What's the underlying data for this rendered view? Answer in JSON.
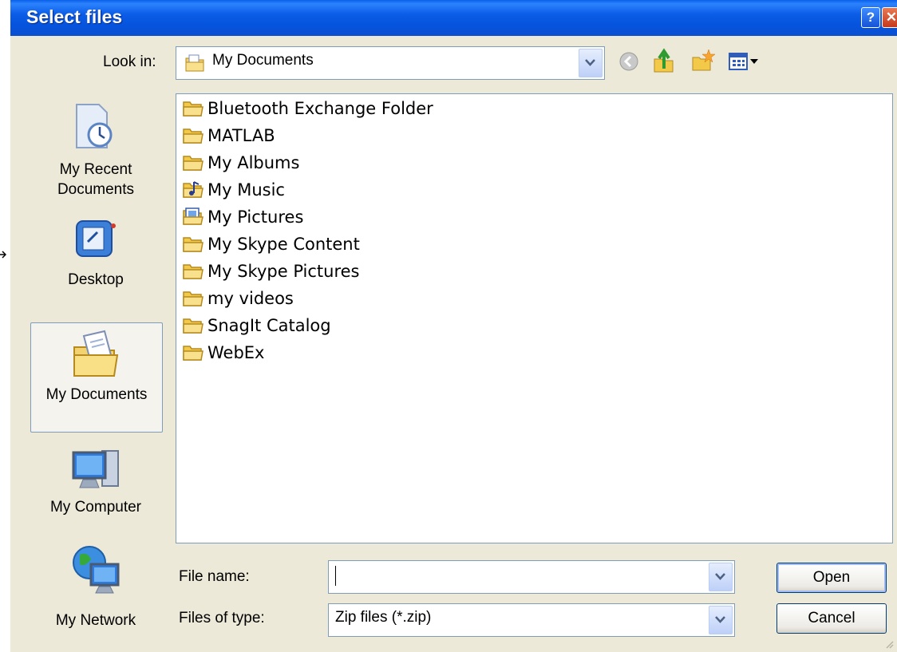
{
  "dialog": {
    "title": "Select files",
    "help_icon": "help-icon",
    "close_icon": "close-icon"
  },
  "look_in": {
    "label": "Look in:",
    "value": "My Documents"
  },
  "toolbar": {
    "icons": [
      "back-icon",
      "up-folder-icon",
      "new-folder-icon",
      "view-menu-icon"
    ]
  },
  "places": [
    {
      "label": "My Recent Documents",
      "line1": "My Recent",
      "line2": "Documents"
    },
    {
      "label": "Desktop"
    },
    {
      "label": "My Documents"
    },
    {
      "label": "My Computer"
    },
    {
      "label": "My Network"
    }
  ],
  "files": [
    {
      "name": "Bluetooth Exchange Folder",
      "icon": "folder-icon"
    },
    {
      "name": "MATLAB",
      "icon": "folder-icon"
    },
    {
      "name": "My Albums",
      "icon": "folder-icon"
    },
    {
      "name": "My Music",
      "icon": "music-folder-icon"
    },
    {
      "name": "My Pictures",
      "icon": "pictures-folder-icon"
    },
    {
      "name": "My Skype Content",
      "icon": "folder-icon"
    },
    {
      "name": "My Skype Pictures",
      "icon": "folder-icon"
    },
    {
      "name": "my videos",
      "icon": "folder-icon"
    },
    {
      "name": "SnagIt Catalog",
      "icon": "folder-icon"
    },
    {
      "name": "WebEx",
      "icon": "folder-icon"
    }
  ],
  "file_name": {
    "label": "File name:",
    "value": ""
  },
  "file_type": {
    "label": "Files of type:",
    "value": "Zip files (*.zip)"
  },
  "buttons": {
    "open": "Open",
    "cancel": "Cancel"
  },
  "colors": {
    "titlebar": "#0A5FEA",
    "dialog_bg": "#ECE9D8",
    "border": "#7F9DB9"
  }
}
